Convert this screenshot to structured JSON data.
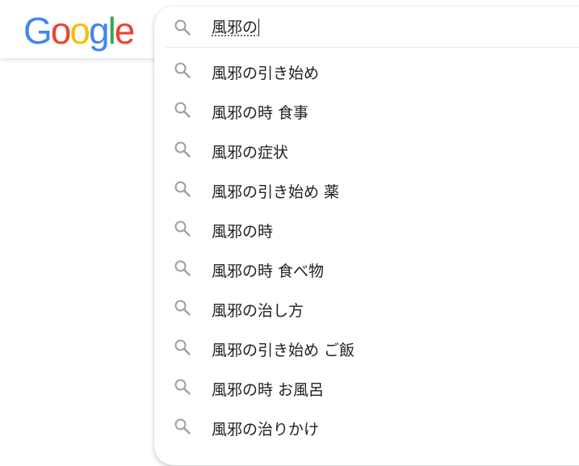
{
  "logo": {
    "letters": [
      "G",
      "o",
      "o",
      "g",
      "l",
      "e"
    ],
    "colors": [
      "#4285F4",
      "#EA4335",
      "#FBBC05",
      "#4285F4",
      "#34A853",
      "#EA4335"
    ]
  },
  "search": {
    "value": "風邪の",
    "icon": "search-icon",
    "icon_color": "#9aa0a6"
  },
  "suggestions": [
    "風邪の引き始め",
    "風邪の時 食事",
    "風邪の症状",
    "風邪の引き始め 薬",
    "風邪の時",
    "風邪の時 食べ物",
    "風邪の治し方",
    "風邪の引き始め ご飯",
    "風邪の時 お風呂",
    "風邪の治りかけ"
  ]
}
